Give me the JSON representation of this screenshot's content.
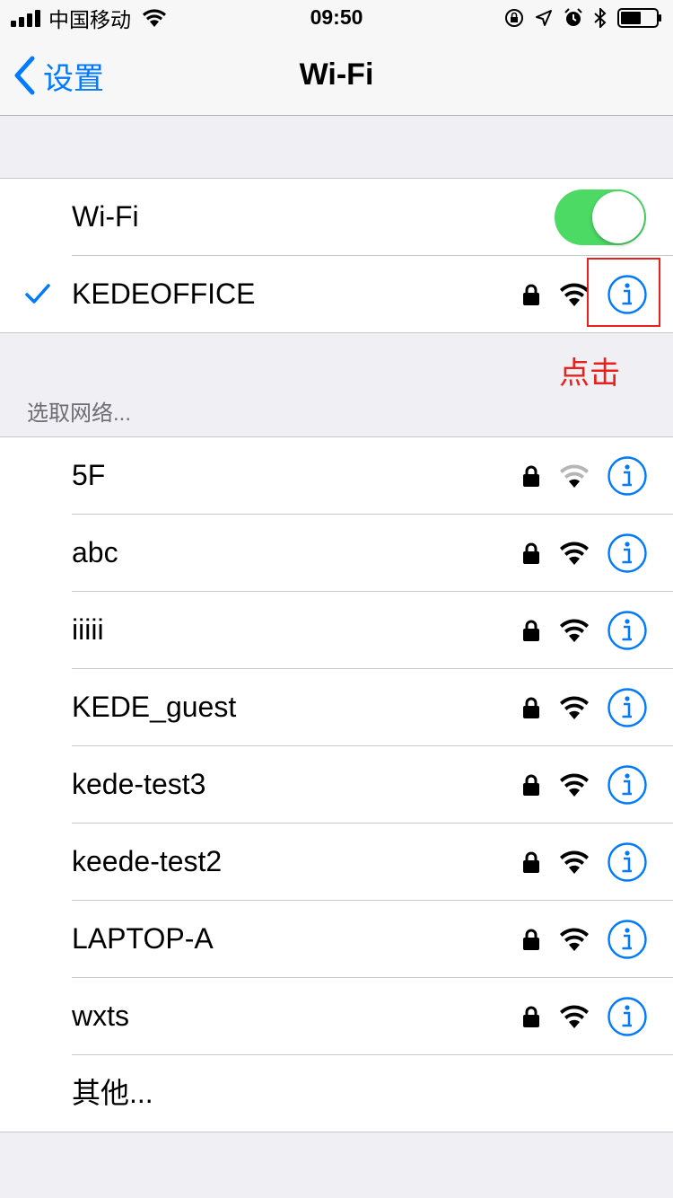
{
  "status_bar": {
    "carrier": "中国移动",
    "time": "09:50"
  },
  "nav": {
    "back_label": "设置",
    "title": "Wi-Fi"
  },
  "wifi_toggle": {
    "label": "Wi-Fi",
    "on": true
  },
  "connected": {
    "name": "KEDEOFFICE",
    "secured": true
  },
  "annotation": "点击",
  "section_header": "选取网络...",
  "networks": [
    {
      "name": "5F",
      "secured": true,
      "signal": "weak"
    },
    {
      "name": "abc",
      "secured": true,
      "signal": "strong"
    },
    {
      "name": "iiiii",
      "secured": true,
      "signal": "strong"
    },
    {
      "name": "KEDE_guest",
      "secured": true,
      "signal": "strong"
    },
    {
      "name": "kede-test3",
      "secured": true,
      "signal": "strong"
    },
    {
      "name": "keede-test2",
      "secured": true,
      "signal": "strong"
    },
    {
      "name": "LAPTOP-A",
      "secured": true,
      "signal": "strong"
    },
    {
      "name": "wxts",
      "secured": true,
      "signal": "strong"
    }
  ],
  "other_label": "其他...",
  "colors": {
    "accent": "#007aff",
    "toggle_on": "#4cd964",
    "annotation": "#e8211c"
  }
}
